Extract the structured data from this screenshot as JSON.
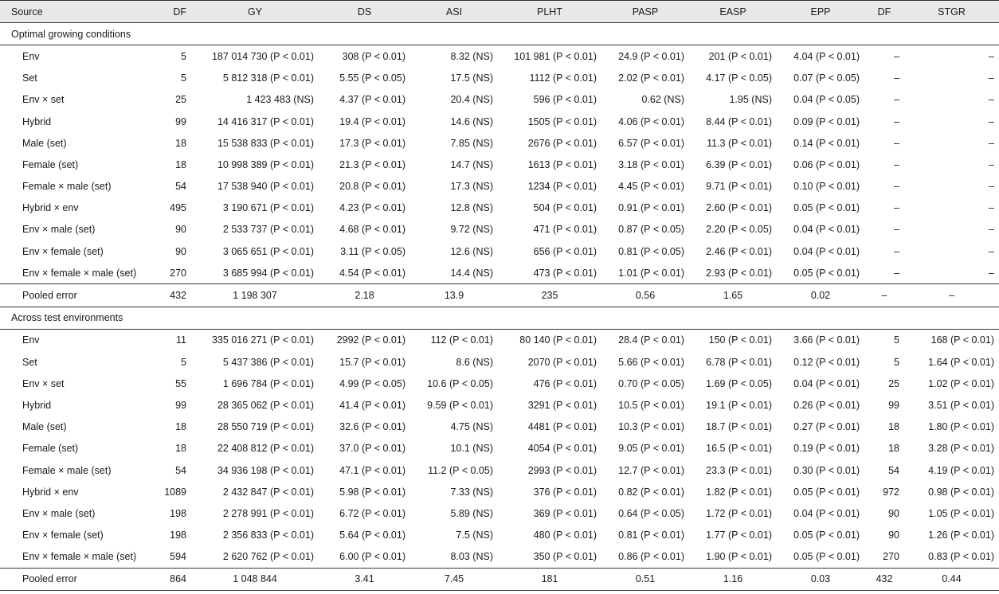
{
  "headers": [
    "Source",
    "DF",
    "GY",
    "DS",
    "ASI",
    "PLHT",
    "PASP",
    "EASP",
    "EPP",
    "DF",
    "STGR"
  ],
  "sections": [
    {
      "title": "Optimal growing conditions",
      "rows": [
        {
          "source": "Env",
          "df": "5",
          "gy": "187 014 730",
          "gy_p": "(P < 0.01)",
          "ds": "308",
          "ds_p": "(P < 0.01)",
          "asi": "8.32",
          "asi_p": "(NS)",
          "plht": "101 981",
          "plht_p": "(P < 0.01)",
          "pasp": "24.9",
          "pasp_p": "(P < 0.01)",
          "easp": "201",
          "easp_p": "(P < 0.01)",
          "epp": "4.04",
          "epp_p": "(P < 0.01)",
          "df2": "–",
          "stgr": "–",
          "stgr_p": ""
        },
        {
          "source": "Set",
          "df": "5",
          "gy": "5 812 318",
          "gy_p": "(P < 0.01)",
          "ds": "5.55",
          "ds_p": "(P < 0.05)",
          "asi": "17.5",
          "asi_p": "(NS)",
          "plht": "1112",
          "plht_p": "(P < 0.01)",
          "pasp": "2.02",
          "pasp_p": "(P < 0.01)",
          "easp": "4.17",
          "easp_p": "(P < 0.05)",
          "epp": "0.07",
          "epp_p": "(P < 0.05)",
          "df2": "–",
          "stgr": "–",
          "stgr_p": ""
        },
        {
          "source": "Env × set",
          "df": "25",
          "gy": "1 423 483",
          "gy_p": "(NS)",
          "ds": "4.37",
          "ds_p": "(P < 0.01)",
          "asi": "20.4",
          "asi_p": "(NS)",
          "plht": "596",
          "plht_p": "(P < 0.01)",
          "pasp": "0.62",
          "pasp_p": "(NS)",
          "easp": "1.95",
          "easp_p": "(NS)",
          "epp": "0.04",
          "epp_p": "(P < 0.05)",
          "df2": "–",
          "stgr": "–",
          "stgr_p": ""
        },
        {
          "source": "Hybrid",
          "df": "99",
          "gy": "14 416 317",
          "gy_p": "(P < 0.01)",
          "ds": "19.4",
          "ds_p": "(P < 0.01)",
          "asi": "14.6",
          "asi_p": "(NS)",
          "plht": "1505",
          "plht_p": "(P < 0.01)",
          "pasp": "4.06",
          "pasp_p": "(P < 0.01)",
          "easp": "8.44",
          "easp_p": "(P < 0.01)",
          "epp": "0.09",
          "epp_p": "(P < 0.01)",
          "df2": "–",
          "stgr": "–",
          "stgr_p": ""
        },
        {
          "source": "Male (set)",
          "df": "18",
          "gy": "15 538 833",
          "gy_p": "(P < 0.01)",
          "ds": "17.3",
          "ds_p": "(P < 0.01)",
          "asi": "7.85",
          "asi_p": "(NS)",
          "plht": "2676",
          "plht_p": "(P < 0.01)",
          "pasp": "6.57",
          "pasp_p": "(P < 0.01)",
          "easp": "11.3",
          "easp_p": "(P < 0.01)",
          "epp": "0.14",
          "epp_p": "(P < 0.01)",
          "df2": "–",
          "stgr": "–",
          "stgr_p": ""
        },
        {
          "source": "Female (set)",
          "df": "18",
          "gy": "10 998 389",
          "gy_p": "(P < 0.01)",
          "ds": "21.3",
          "ds_p": "(P < 0.01)",
          "asi": "14.7",
          "asi_p": "(NS)",
          "plht": "1613",
          "plht_p": "(P < 0.01)",
          "pasp": "3.18",
          "pasp_p": "(P < 0.01)",
          "easp": "6.39",
          "easp_p": "(P < 0.01)",
          "epp": "0.06",
          "epp_p": "(P < 0.01)",
          "df2": "–",
          "stgr": "–",
          "stgr_p": ""
        },
        {
          "source": "Female × male (set)",
          "df": "54",
          "gy": "17 538 940",
          "gy_p": "(P < 0.01)",
          "ds": "20.8",
          "ds_p": "(P < 0.01)",
          "asi": "17.3",
          "asi_p": "(NS)",
          "plht": "1234",
          "plht_p": "(P < 0.01)",
          "pasp": "4.45",
          "pasp_p": "(P < 0.01)",
          "easp": "9.71",
          "easp_p": "(P < 0.01)",
          "epp": "0.10",
          "epp_p": "(P < 0.01)",
          "df2": "–",
          "stgr": "–",
          "stgr_p": ""
        },
        {
          "source": "Hybrid × env",
          "df": "495",
          "gy": "3 190 671",
          "gy_p": "(P < 0.01)",
          "ds": "4.23",
          "ds_p": "(P < 0.01)",
          "asi": "12.8",
          "asi_p": "(NS)",
          "plht": "504",
          "plht_p": "(P < 0.01)",
          "pasp": "0.91",
          "pasp_p": "(P < 0.01)",
          "easp": "2.60",
          "easp_p": "(P < 0.01)",
          "epp": "0.05",
          "epp_p": "(P < 0.01)",
          "df2": "–",
          "stgr": "–",
          "stgr_p": ""
        },
        {
          "source": "Env × male (set)",
          "df": "90",
          "gy": "2 533 737",
          "gy_p": "(P < 0.01)",
          "ds": "4.68",
          "ds_p": "(P < 0.01)",
          "asi": "9.72",
          "asi_p": "(NS)",
          "plht": "471",
          "plht_p": "(P < 0.01)",
          "pasp": "0.87",
          "pasp_p": "(P < 0.05)",
          "easp": "2.20",
          "easp_p": "(P < 0.05)",
          "epp": "0.04",
          "epp_p": "(P < 0.01)",
          "df2": "–",
          "stgr": "–",
          "stgr_p": ""
        },
        {
          "source": "Env × female (set)",
          "df": "90",
          "gy": "3 065 651",
          "gy_p": "(P < 0.01)",
          "ds": "3.11",
          "ds_p": "(P < 0.05)",
          "asi": "12.6",
          "asi_p": "(NS)",
          "plht": "656",
          "plht_p": "(P < 0.01)",
          "pasp": "0.81",
          "pasp_p": "(P < 0.05)",
          "easp": "2.46",
          "easp_p": "(P < 0.01)",
          "epp": "0.04",
          "epp_p": "(P < 0.01)",
          "df2": "–",
          "stgr": "–",
          "stgr_p": ""
        },
        {
          "source": "Env × female × male (set)",
          "df": "270",
          "gy": "3 685 994",
          "gy_p": "(P < 0.01)",
          "ds": "4.54",
          "ds_p": "(P < 0.01)",
          "asi": "14.4",
          "asi_p": "(NS)",
          "plht": "473",
          "plht_p": "(P < 0.01)",
          "pasp": "1.01",
          "pasp_p": "(P < 0.01)",
          "easp": "2.93",
          "easp_p": "(P < 0.01)",
          "epp": "0.05",
          "epp_p": "(P < 0.01)",
          "df2": "–",
          "stgr": "–",
          "stgr_p": ""
        }
      ],
      "error": {
        "source": "Pooled error",
        "df": "432",
        "gy": "1 198 307",
        "ds": "2.18",
        "asi": "13.9",
        "plht": "235",
        "pasp": "0.56",
        "easp": "1.65",
        "epp": "0.02",
        "df2": "–",
        "stgr": "–"
      }
    },
    {
      "title": "Across test environments",
      "rows": [
        {
          "source": "Env",
          "df": "11",
          "gy": "335 016 271",
          "gy_p": "(P < 0.01)",
          "ds": "2992",
          "ds_p": "(P < 0.01)",
          "asi": "112",
          "asi_p": "(P < 0.01)",
          "plht": "80 140",
          "plht_p": "(P < 0.01)",
          "pasp": "28.4",
          "pasp_p": "(P < 0.01)",
          "easp": "150",
          "easp_p": "(P < 0.01)",
          "epp": "3.66",
          "epp_p": "(P < 0.01)",
          "df2": "5",
          "stgr": "168",
          "stgr_p": "(P < 0.01)"
        },
        {
          "source": "Set",
          "df": "5",
          "gy": "5 437 386",
          "gy_p": "(P < 0.01)",
          "ds": "15.7",
          "ds_p": "(P < 0.01)",
          "asi": "8.6",
          "asi_p": "(NS)",
          "plht": "2070",
          "plht_p": "(P < 0.01)",
          "pasp": "5.66",
          "pasp_p": "(P < 0.01)",
          "easp": "6.78",
          "easp_p": "(P < 0.01)",
          "epp": "0.12",
          "epp_p": "(P < 0.01)",
          "df2": "5",
          "stgr": "1.64",
          "stgr_p": "(P < 0.01)"
        },
        {
          "source": "Env × set",
          "df": "55",
          "gy": "1 696 784",
          "gy_p": "(P < 0.01)",
          "ds": "4.99",
          "ds_p": "(P < 0.05)",
          "asi": "10.6",
          "asi_p": "(P < 0.05)",
          "plht": "476",
          "plht_p": "(P < 0.01)",
          "pasp": "0.70",
          "pasp_p": "(P < 0.05)",
          "easp": "1.69",
          "easp_p": "(P < 0.05)",
          "epp": "0.04",
          "epp_p": "(P < 0.01)",
          "df2": "25",
          "stgr": "1.02",
          "stgr_p": "(P < 0.01)"
        },
        {
          "source": "Hybrid",
          "df": "99",
          "gy": "28 365 062",
          "gy_p": "(P < 0.01)",
          "ds": "41.4",
          "ds_p": "(P < 0.01)",
          "asi": "9.59",
          "asi_p": "(P < 0.01)",
          "plht": "3291",
          "plht_p": "(P < 0.01)",
          "pasp": "10.5",
          "pasp_p": "(P < 0.01)",
          "easp": "19.1",
          "easp_p": "(P < 0.01)",
          "epp": "0.26",
          "epp_p": "(P < 0.01)",
          "df2": "99",
          "stgr": "3.51",
          "stgr_p": "(P < 0.01)"
        },
        {
          "source": "Male (set)",
          "df": "18",
          "gy": "28 550 719",
          "gy_p": "(P < 0.01)",
          "ds": "32.6",
          "ds_p": "(P < 0.01)",
          "asi": "4.75",
          "asi_p": "(NS)",
          "plht": "4481",
          "plht_p": "(P < 0.01)",
          "pasp": "10.3",
          "pasp_p": "(P < 0.01)",
          "easp": "18.7",
          "easp_p": "(P < 0.01)",
          "epp": "0.27",
          "epp_p": "(P < 0.01)",
          "df2": "18",
          "stgr": "1.80",
          "stgr_p": "(P < 0.01)"
        },
        {
          "source": "Female (set)",
          "df": "18",
          "gy": "22 408 812",
          "gy_p": "(P < 0.01)",
          "ds": "37.0",
          "ds_p": "(P < 0.01)",
          "asi": "10.1",
          "asi_p": "(NS)",
          "plht": "4054",
          "plht_p": "(P < 0.01)",
          "pasp": "9.05",
          "pasp_p": "(P < 0.01)",
          "easp": "16.5",
          "easp_p": "(P < 0.01)",
          "epp": "0.19",
          "epp_p": "(P < 0.01)",
          "df2": "18",
          "stgr": "3.28",
          "stgr_p": "(P < 0.01)"
        },
        {
          "source": "Female × male (set)",
          "df": "54",
          "gy": "34 936 198",
          "gy_p": "(P < 0.01)",
          "ds": "47.1",
          "ds_p": "(P < 0.01)",
          "asi": "11.2",
          "asi_p": "(P < 0.05)",
          "plht": "2993",
          "plht_p": "(P < 0.01)",
          "pasp": "12.7",
          "pasp_p": "(P < 0.01)",
          "easp": "23.3",
          "easp_p": "(P < 0.01)",
          "epp": "0.30",
          "epp_p": "(P < 0.01)",
          "df2": "54",
          "stgr": "4.19",
          "stgr_p": "(P < 0.01)"
        },
        {
          "source": "Hybrid × env",
          "df": "1089",
          "gy": "2 432 847",
          "gy_p": "(P < 0.01)",
          "ds": "5.98",
          "ds_p": "(P < 0.01)",
          "asi": "7.33",
          "asi_p": "(NS)",
          "plht": "376",
          "plht_p": "(P < 0.01)",
          "pasp": "0.82",
          "pasp_p": "(P < 0.01)",
          "easp": "1.82",
          "easp_p": "(P < 0.01)",
          "epp": "0.05",
          "epp_p": "(P < 0.01)",
          "df2": "972",
          "stgr": "0.98",
          "stgr_p": "(P < 0.01)"
        },
        {
          "source": "Env × male (set)",
          "df": "198",
          "gy": "2 278 991",
          "gy_p": "(P < 0.01)",
          "ds": "6.72",
          "ds_p": "(P < 0.01)",
          "asi": "5.89",
          "asi_p": "(NS)",
          "plht": "369",
          "plht_p": "(P < 0.01)",
          "pasp": "0.64",
          "pasp_p": "(P < 0.05)",
          "easp": "1.72",
          "easp_p": "(P < 0.01)",
          "epp": "0.04",
          "epp_p": "(P < 0.01)",
          "df2": "90",
          "stgr": "1.05",
          "stgr_p": "(P < 0.01)"
        },
        {
          "source": "Env × female (set)",
          "df": "198",
          "gy": "2 356 833",
          "gy_p": "(P < 0.01)",
          "ds": "5.64",
          "ds_p": "(P < 0.01)",
          "asi": "7.5",
          "asi_p": "(NS)",
          "plht": "480",
          "plht_p": "(P < 0.01)",
          "pasp": "0.81",
          "pasp_p": "(P < 0.01)",
          "easp": "1.77",
          "easp_p": "(P < 0.01)",
          "epp": "0.05",
          "epp_p": "(P < 0.01)",
          "df2": "90",
          "stgr": "1.26",
          "stgr_p": "(P < 0.01)"
        },
        {
          "source": "Env × female × male (set)",
          "df": "594",
          "gy": "2 620 762",
          "gy_p": "(P < 0.01)",
          "ds": "6.00",
          "ds_p": "(P < 0.01)",
          "asi": "8.03",
          "asi_p": "(NS)",
          "plht": "350",
          "plht_p": "(P < 0.01)",
          "pasp": "0.86",
          "pasp_p": "(P < 0.01)",
          "easp": "1.90",
          "easp_p": "(P < 0.01)",
          "epp": "0.05",
          "epp_p": "(P < 0.01)",
          "df2": "270",
          "stgr": "0.83",
          "stgr_p": "(P < 0.01)"
        }
      ],
      "error": {
        "source": "Pooled error",
        "df": "864",
        "gy": "1 048 844",
        "ds": "3.41",
        "asi": "7.45",
        "plht": "181",
        "pasp": "0.51",
        "easp": "1.16",
        "epp": "0.03",
        "df2": "432",
        "stgr": "0.44"
      }
    }
  ]
}
